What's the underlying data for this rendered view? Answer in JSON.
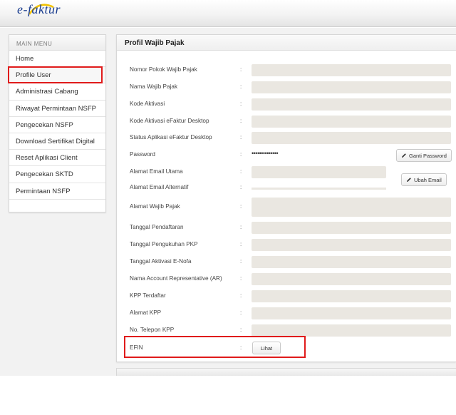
{
  "app": {
    "logo_text": "e-faktur"
  },
  "colors": {
    "highlight": "#e01b1b",
    "field_bg": "#eae7e1",
    "logo": "#1a3d8f"
  },
  "sidebar": {
    "header": "MAIN MENU",
    "items": [
      {
        "label": "Home"
      },
      {
        "label": "Profile User"
      },
      {
        "label": "Administrasi Cabang"
      },
      {
        "label": "Riwayat Permintaan NSFP"
      },
      {
        "label": "Pengecekan NSFP"
      },
      {
        "label": "Download Sertifikat Digital"
      },
      {
        "label": "Reset Aplikasi Client"
      },
      {
        "label": "Pengecekan SKTD"
      },
      {
        "label": "Permintaan NSFP"
      }
    ]
  },
  "panel": {
    "title": "Profil Wajib Pajak",
    "colon": ":",
    "fields": [
      {
        "label": "Nomor Pokok Wajib Pajak"
      },
      {
        "label": "Nama Wajib Pajak"
      },
      {
        "label": "Kode Aktivasi"
      },
      {
        "label": "Kode Aktivasi eFaktur Desktop"
      },
      {
        "label": "Status Aplikasi eFaktur Desktop"
      },
      {
        "label": "Password",
        "value": "••••••••••••••"
      },
      {
        "label": "Alamat Email Utama"
      },
      {
        "label": "Alamat Email Alternatif"
      },
      {
        "label": "Alamat Wajib Pajak"
      },
      {
        "label": "Tanggal Pendaftaran"
      },
      {
        "label": "Tanggal Pengukuhan PKP"
      },
      {
        "label": "Tanggal Aktivasi E-Nofa"
      },
      {
        "label": "Nama Account Representative (AR)"
      },
      {
        "label": "KPP Terdaftar"
      },
      {
        "label": "Alamat KPP"
      },
      {
        "label": "No. Telepon KPP"
      },
      {
        "label": "EFIN"
      }
    ],
    "buttons": {
      "ganti_password": "Ganti Password",
      "ubah_email": "Ubah Email",
      "lihat": "Lihat"
    },
    "button_icon": "pencil-icon"
  }
}
